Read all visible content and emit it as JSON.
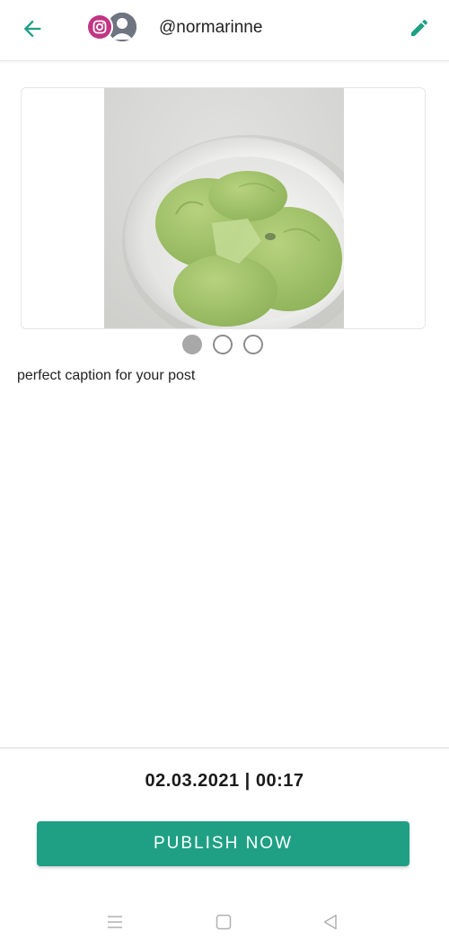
{
  "header": {
    "username": "@normarinne",
    "back_icon": "arrow-left-icon",
    "edit_icon": "pencil-icon",
    "platform_icon": "instagram-icon",
    "accent_color": "#1fa084",
    "instagram_color": "#c13584"
  },
  "media": {
    "image_subject": "matcha-ice-cream-bowl",
    "carousel": {
      "total": 3,
      "active_index": 0
    }
  },
  "post": {
    "caption": "perfect caption for your post"
  },
  "footer": {
    "schedule_datetime": "02.03.2021 | 00:17",
    "publish_label": "PUBLISH NOW"
  },
  "system_nav": {
    "recents_icon": "menu-lines-icon",
    "home_icon": "square-icon",
    "back_icon": "triangle-back-icon"
  }
}
